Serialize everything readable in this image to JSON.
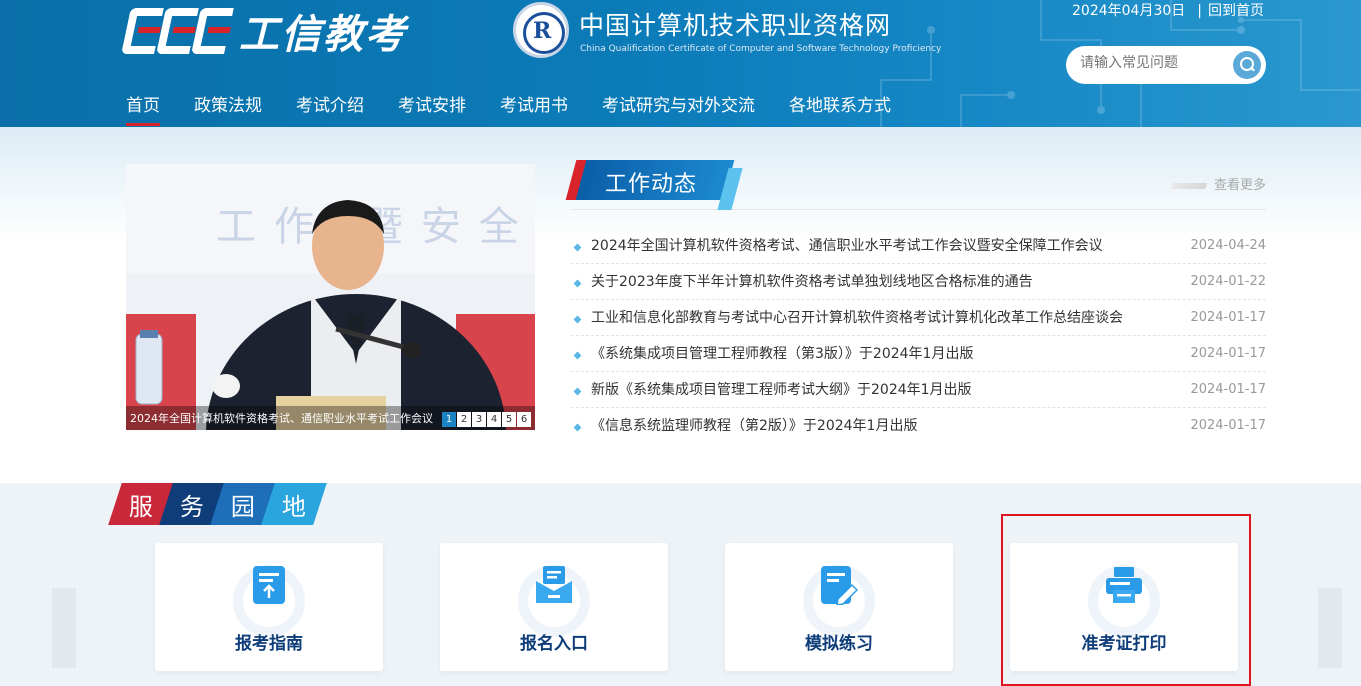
{
  "header": {
    "brand": "工信教考",
    "site_title_cn": "中国计算机技术职业资格网",
    "site_title_en": "China Qualification Certificate of Computer and Software Technology Proficiency",
    "date": "2024年04月30日",
    "home_link": "回到首页",
    "search": {
      "placeholder": "请输入常见问题"
    },
    "nav": [
      {
        "label": "首页",
        "active": true
      },
      {
        "label": "政策法规"
      },
      {
        "label": "考试介绍"
      },
      {
        "label": "考试安排"
      },
      {
        "label": "考试用书"
      },
      {
        "label": "考试研究与对外交流"
      },
      {
        "label": "各地联系方式"
      }
    ]
  },
  "slider": {
    "caption": "2024年全国计算机软件资格考试、通信职业水平考试工作会议",
    "pages": [
      "1",
      "2",
      "3",
      "4",
      "5",
      "6"
    ],
    "active_page": "1"
  },
  "news": {
    "title": "工作动态",
    "more": "查看更多",
    "items": [
      {
        "title": "2024年全国计算机软件资格考试、通信职业水平考试工作会议暨安全保障工作会议",
        "date": "2024-04-24"
      },
      {
        "title": "关于2023年度下半年计算机软件资格考试单独划线地区合格标准的通告",
        "date": "2024-01-22"
      },
      {
        "title": "工业和信息化部教育与考试中心召开计算机软件资格考试计算机化改革工作总结座谈会",
        "date": "2024-01-17"
      },
      {
        "title": "《系统集成项目管理工程师教程（第3版）》于2024年1月出版",
        "date": "2024-01-17"
      },
      {
        "title": "新版《系统集成项目管理工程师考试大纲》于2024年1月出版",
        "date": "2024-01-17"
      },
      {
        "title": "《信息系统监理师教程（第2版）》于2024年1月出版",
        "date": "2024-01-17"
      }
    ]
  },
  "service": {
    "title_chars": [
      "服",
      "务",
      "园",
      "地"
    ],
    "cards": [
      {
        "label": "报考指南",
        "icon": "document-upload-icon"
      },
      {
        "label": "报名入口",
        "icon": "mail-inbox-icon"
      },
      {
        "label": "模拟练习",
        "icon": "edit-pen-icon"
      },
      {
        "label": "准考证打印",
        "icon": "printer-icon"
      }
    ]
  },
  "colors": {
    "header_blue": "#0b7bb8",
    "accent_red": "#d8232a",
    "title_navy": "#0e3d7a",
    "icon_blue": "#2a9be8"
  }
}
